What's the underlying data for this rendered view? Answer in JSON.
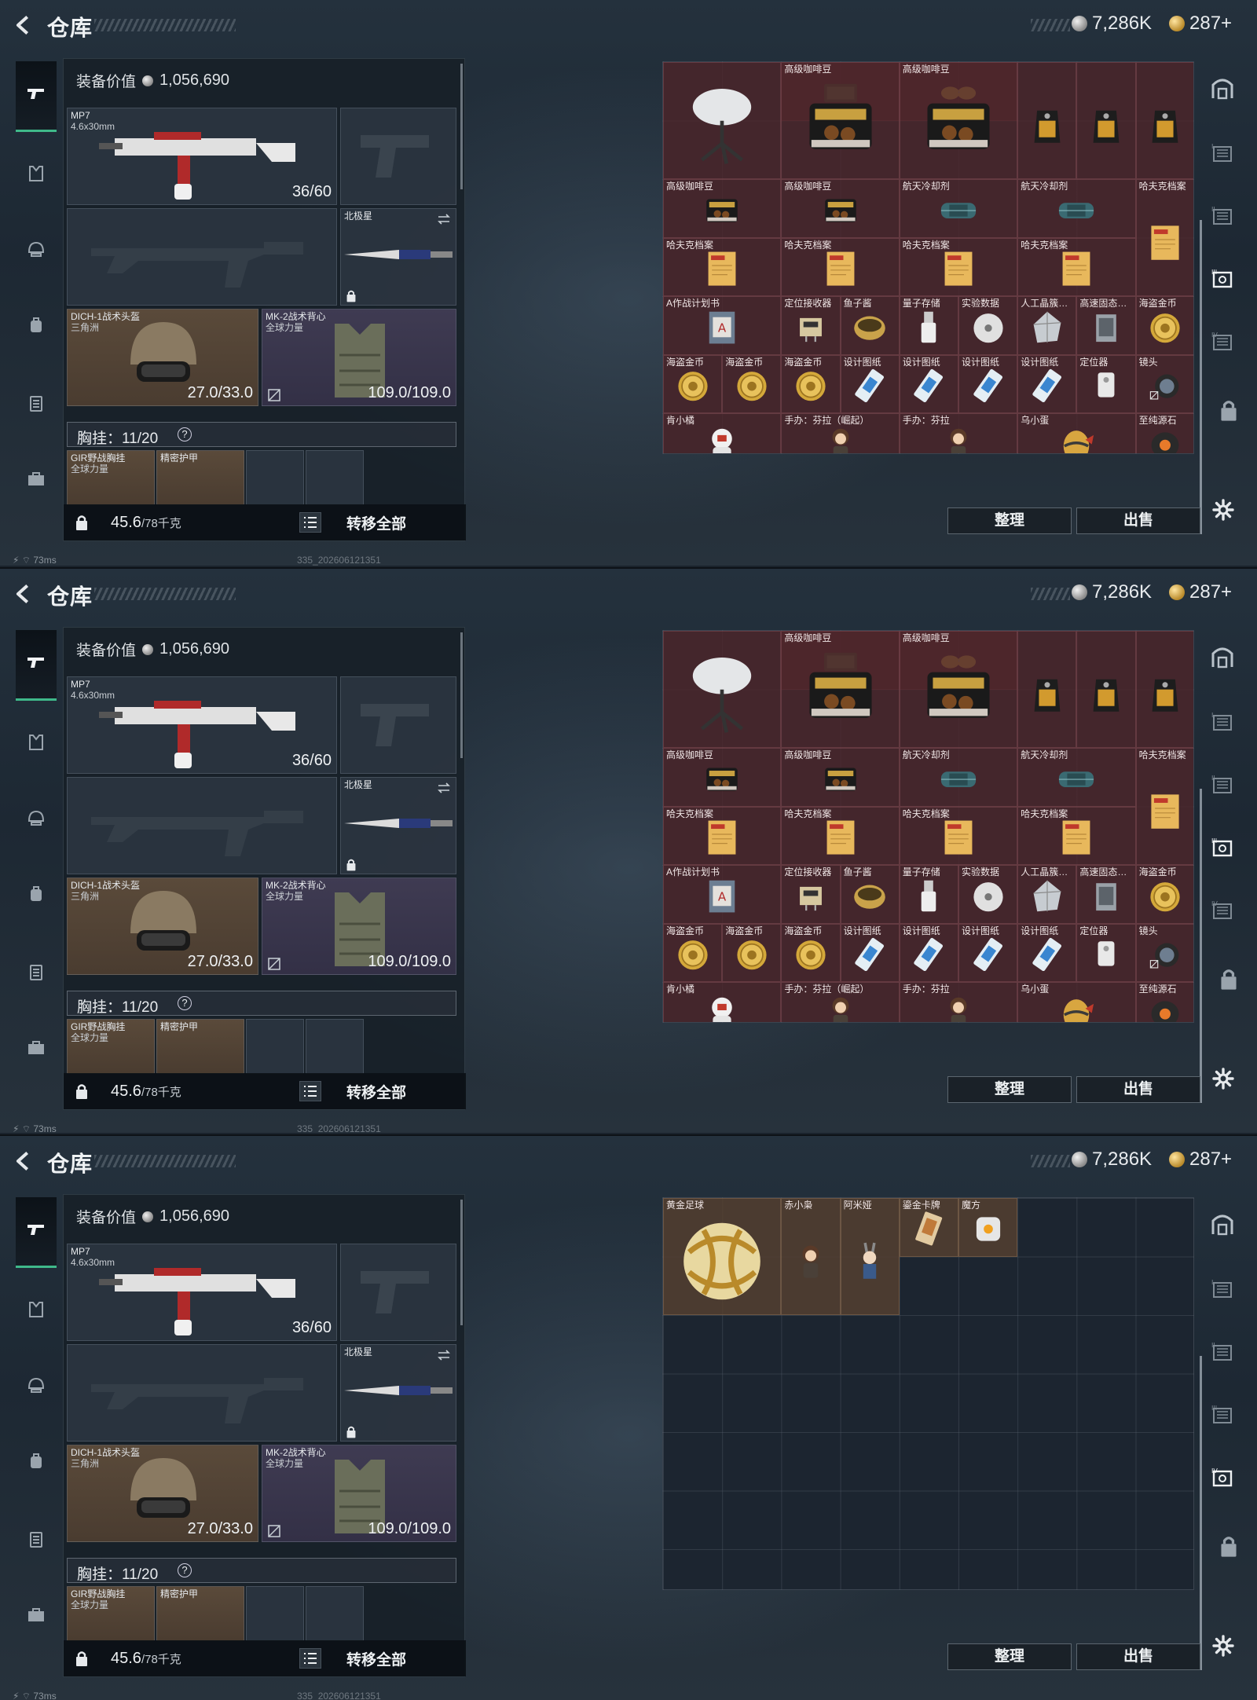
{
  "title": "仓库",
  "currency": {
    "silver": "7,286K",
    "gold": "287+"
  },
  "loadout": {
    "equip_value_label": "装备价值",
    "equip_value": "1,056,690",
    "primary": {
      "name": "MP7",
      "ammo_type": "4.6x30mm",
      "ammo": "36/60"
    },
    "melee": {
      "name": "北极星"
    },
    "helmet": {
      "name": "DICH-1战术头盔",
      "brand": "三角洲",
      "durability": "27.0/33.0"
    },
    "armor": {
      "name": "MK-2战术背心",
      "brand": "全球力量",
      "durability": "109.0/109.0"
    },
    "chest_rig": {
      "label": "胸挂：",
      "value": "11/20",
      "help": "?"
    },
    "rig_item": {
      "name": "GIR野战胸挂",
      "brand": "全球力量"
    },
    "rig_item2": {
      "name": "精密护甲"
    },
    "weight": "45.6",
    "weight_cap": "/78千克",
    "transfer_all": "转移全部"
  },
  "stash_screen1": [
    {
      "name": "",
      "icon": "satellite-dish-icon",
      "c": 0,
      "r": 0,
      "w": 2,
      "h": 2,
      "bg": "red"
    },
    {
      "name": "",
      "icon": "case-icon",
      "c": 2,
      "r": 0,
      "w": 2,
      "h": 1,
      "bg": "red",
      "hideLabel": true
    },
    {
      "name": "高级咖啡豆",
      "icon": "coffee-beans-icon",
      "c": 2,
      "r": 0,
      "w": 2,
      "h": 2,
      "bg": "red"
    },
    {
      "name": "",
      "icon": "sunglasses-icon",
      "c": 4,
      "r": 0,
      "w": 2,
      "h": 1,
      "bg": "red",
      "hideLabel": true
    },
    {
      "name": "高级咖啡豆",
      "icon": "coffee-beans-icon",
      "c": 4,
      "r": 0,
      "w": 2,
      "h": 2,
      "bg": "red"
    },
    {
      "name": "",
      "icon": "coffee-bag-icon",
      "c": 6,
      "r": 0,
      "w": 1,
      "h": 2,
      "bg": "red"
    },
    {
      "name": "",
      "icon": "coffee-bag-icon",
      "c": 7,
      "r": 0,
      "w": 1,
      "h": 2,
      "bg": "red"
    },
    {
      "name": "",
      "icon": "coffee-bag-icon",
      "c": 8,
      "r": 0,
      "w": 1,
      "h": 2,
      "bg": "red"
    },
    {
      "name": "高级咖啡豆",
      "icon": "coffee-beans-icon",
      "c": 0,
      "r": 2,
      "w": 2,
      "h": 1,
      "bg": "red"
    },
    {
      "name": "高级咖啡豆",
      "icon": "coffee-beans-icon",
      "c": 2,
      "r": 2,
      "w": 2,
      "h": 1,
      "bg": "red"
    },
    {
      "name": "航天冷却剂",
      "icon": "coolant-icon",
      "c": 4,
      "r": 2,
      "w": 2,
      "h": 1,
      "bg": "red"
    },
    {
      "name": "航天冷却剂",
      "icon": "coolant-icon",
      "c": 6,
      "r": 2,
      "w": 2,
      "h": 1,
      "bg": "red"
    },
    {
      "name": "哈夫克档案",
      "icon": "file-icon",
      "c": 8,
      "r": 2,
      "w": 1,
      "h": 2,
      "bg": "red"
    },
    {
      "name": "哈夫克档案",
      "icon": "file-icon",
      "c": 0,
      "r": 3,
      "w": 2,
      "h": 1,
      "bg": "red"
    },
    {
      "name": "哈夫克档案",
      "icon": "file-icon",
      "c": 2,
      "r": 3,
      "w": 2,
      "h": 1,
      "bg": "red"
    },
    {
      "name": "哈夫克档案",
      "icon": "file-icon",
      "c": 4,
      "r": 3,
      "w": 2,
      "h": 1,
      "bg": "red"
    },
    {
      "name": "哈夫克档案",
      "icon": "file-icon",
      "c": 6,
      "r": 3,
      "w": 2,
      "h": 1,
      "bg": "red"
    },
    {
      "name": "A作战计划书",
      "icon": "book-icon",
      "c": 0,
      "r": 4,
      "w": 2,
      "h": 1,
      "bg": "red"
    },
    {
      "name": "定位接收器",
      "icon": "receiver-icon",
      "c": 2,
      "r": 4,
      "w": 1,
      "h": 1,
      "bg": "red"
    },
    {
      "name": "鱼子酱",
      "icon": "caviar-icon",
      "c": 3,
      "r": 4,
      "w": 1,
      "h": 1,
      "bg": "red"
    },
    {
      "name": "量子存储",
      "icon": "usb-icon",
      "c": 4,
      "r": 4,
      "w": 1,
      "h": 1,
      "bg": "red"
    },
    {
      "name": "实验数据",
      "icon": "disc-icon",
      "c": 5,
      "r": 4,
      "w": 1,
      "h": 1,
      "bg": "red"
    },
    {
      "name": "人工晶簇…",
      "icon": "crystal-icon",
      "c": 6,
      "r": 4,
      "w": 1,
      "h": 1,
      "bg": "red"
    },
    {
      "name": "高速固态…",
      "icon": "ssd-icon",
      "c": 7,
      "r": 4,
      "w": 1,
      "h": 1,
      "bg": "red"
    },
    {
      "name": "海盗金币",
      "icon": "gold-coin-icon",
      "c": 8,
      "r": 4,
      "w": 1,
      "h": 1,
      "bg": "red"
    },
    {
      "name": "海盗金币",
      "icon": "gold-coin-icon",
      "c": 0,
      "r": 5,
      "w": 1,
      "h": 1,
      "bg": "red"
    },
    {
      "name": "海盗金币",
      "icon": "gold-coin-icon",
      "c": 1,
      "r": 5,
      "w": 1,
      "h": 1,
      "bg": "red"
    },
    {
      "name": "海盗金币",
      "icon": "gold-coin-icon",
      "c": 2,
      "r": 5,
      "w": 1,
      "h": 1,
      "bg": "red"
    },
    {
      "name": "设计图纸",
      "icon": "blueprint-icon",
      "c": 3,
      "r": 5,
      "w": 1,
      "h": 1,
      "bg": "red"
    },
    {
      "name": "设计图纸",
      "icon": "blueprint-icon",
      "c": 4,
      "r": 5,
      "w": 1,
      "h": 1,
      "bg": "red"
    },
    {
      "name": "设计图纸",
      "icon": "blueprint-icon",
      "c": 5,
      "r": 5,
      "w": 1,
      "h": 1,
      "bg": "red"
    },
    {
      "name": "设计图纸",
      "icon": "blueprint-icon",
      "c": 6,
      "r": 5,
      "w": 1,
      "h": 1,
      "bg": "red"
    },
    {
      "name": "定位器",
      "icon": "locator-icon",
      "c": 7,
      "r": 5,
      "w": 1,
      "h": 1,
      "bg": "red"
    },
    {
      "name": "镜头",
      "icon": "lens-icon",
      "c": 8,
      "r": 5,
      "w": 1,
      "h": 1,
      "bg": "red"
    },
    {
      "name": "肯小橘",
      "icon": "figure-astronaut-icon",
      "c": 0,
      "r": 6,
      "w": 2,
      "h": 1,
      "bg": "red"
    },
    {
      "name": "手办：芬拉（崛起）",
      "icon": "figure-icon",
      "c": 2,
      "r": 6,
      "w": 2,
      "h": 1,
      "bg": "red"
    },
    {
      "name": "手办：芬拉",
      "icon": "figure-icon",
      "c": 4,
      "r": 6,
      "w": 2,
      "h": 1,
      "bg": "red"
    },
    {
      "name": "乌小蛋",
      "icon": "egg-icon",
      "c": 6,
      "r": 6,
      "w": 2,
      "h": 1,
      "bg": "red"
    },
    {
      "name": "至纯源石",
      "icon": "stone-icon",
      "c": 8,
      "r": 6,
      "w": 1,
      "h": 1,
      "bg": "red"
    }
  ],
  "stash_screen3": [
    {
      "name": "黄金足球",
      "icon": "golden-ball-icon",
      "c": 0,
      "r": 0,
      "w": 2,
      "h": 2,
      "bg": "brown"
    },
    {
      "name": "赤小枭",
      "icon": "figure-icon",
      "c": 2,
      "r": 0,
      "w": 1,
      "h": 2,
      "bg": "brown"
    },
    {
      "name": "阿米娅",
      "icon": "figure-bunny-icon",
      "c": 3,
      "r": 0,
      "w": 1,
      "h": 2,
      "bg": "brown"
    },
    {
      "name": "鎏金卡牌",
      "icon": "card-icon",
      "c": 4,
      "r": 0,
      "w": 1,
      "h": 1,
      "bg": "brown"
    },
    {
      "name": "魔方",
      "icon": "cube-icon",
      "c": 5,
      "r": 0,
      "w": 1,
      "h": 1,
      "bg": "brown"
    }
  ],
  "buttons": {
    "sort": "整理",
    "sell": "出售"
  },
  "status": {
    "ping": "73ms",
    "build": "335_202606121351"
  }
}
